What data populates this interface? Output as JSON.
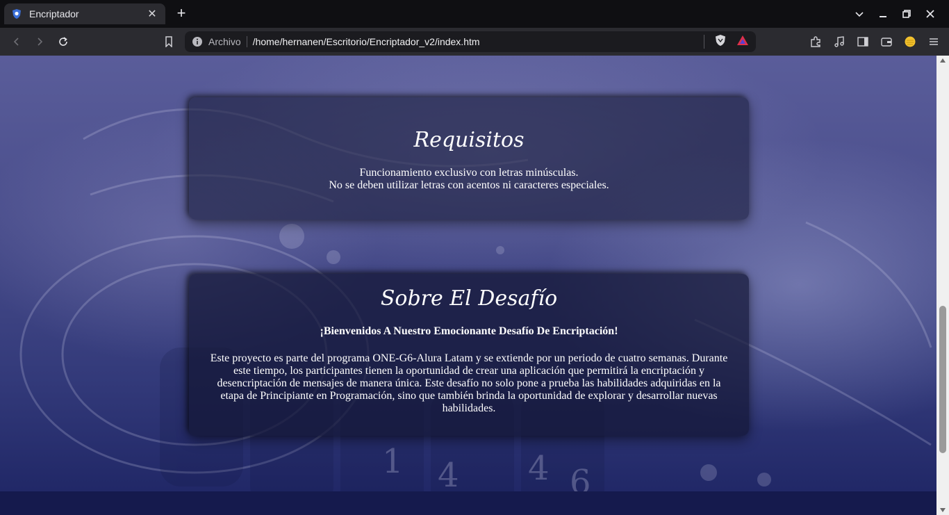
{
  "browser": {
    "tab": {
      "title": "Encriptador",
      "close": "✕"
    },
    "new_tab": "+",
    "address": {
      "label": "Archivo",
      "url": "/home/hernanen/Escritorio/Encriptador_v2/index.htm"
    }
  },
  "page": {
    "requisitos": {
      "title": "Requisitos",
      "lines": [
        "Funcionamiento exclusivo con letras minúsculas.",
        "No se deben utilizar letras con acentos ni caracteres especiales."
      ]
    },
    "desafio": {
      "title": "Sobre El Desafío",
      "subtitle": "¡Bienvenidos A Nuestro Emocionante Desafío De Encriptación!",
      "body": "Este proyecto es parte del programa ONE-G6-Alura Latam y se extiende por un periodo de cuatro semanas. Durante este tiempo, los participantes tienen la oportunidad de crear una aplicación que permitirá la encriptación y desencriptación de mensajes de manera única. Este desafío no solo pone a prueba las habilidades adquiridas en la etapa de Principiante en Programación, sino que también brinda la oportunidad de explorar y desarrollar nuevas habilidades."
    }
  }
}
